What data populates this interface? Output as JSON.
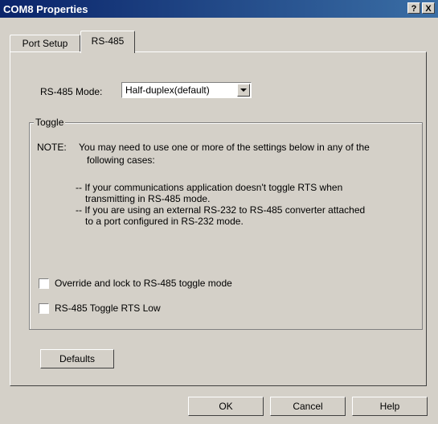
{
  "window": {
    "title": "COM8 Properties",
    "help_glyph": "?",
    "close_glyph": "X"
  },
  "tabs": [
    {
      "label": "Port Setup"
    },
    {
      "label": "RS-485"
    }
  ],
  "mode": {
    "label": "RS-485 Mode:",
    "value": "Half-duplex(default)"
  },
  "toggle": {
    "legend": "Toggle",
    "note_label": "NOTE:",
    "note_line1": "You may need to use one or more of the settings below in any of the",
    "note_line2": "following cases:",
    "case1_line1": "-- If your communications application doesn't toggle RTS when",
    "case1_line2": "transmitting in RS-485  mode.",
    "case2_line1": "-- If you are using an external RS-232 to RS-485 converter attached",
    "case2_line2": "to a port configured in RS-232 mode.",
    "options": [
      {
        "label": "Override and lock to RS-485 toggle mode",
        "checked": false
      },
      {
        "label": "RS-485 Toggle RTS Low",
        "checked": false
      }
    ]
  },
  "buttons": {
    "defaults": "Defaults",
    "ok": "OK",
    "cancel": "Cancel",
    "help": "Help"
  }
}
